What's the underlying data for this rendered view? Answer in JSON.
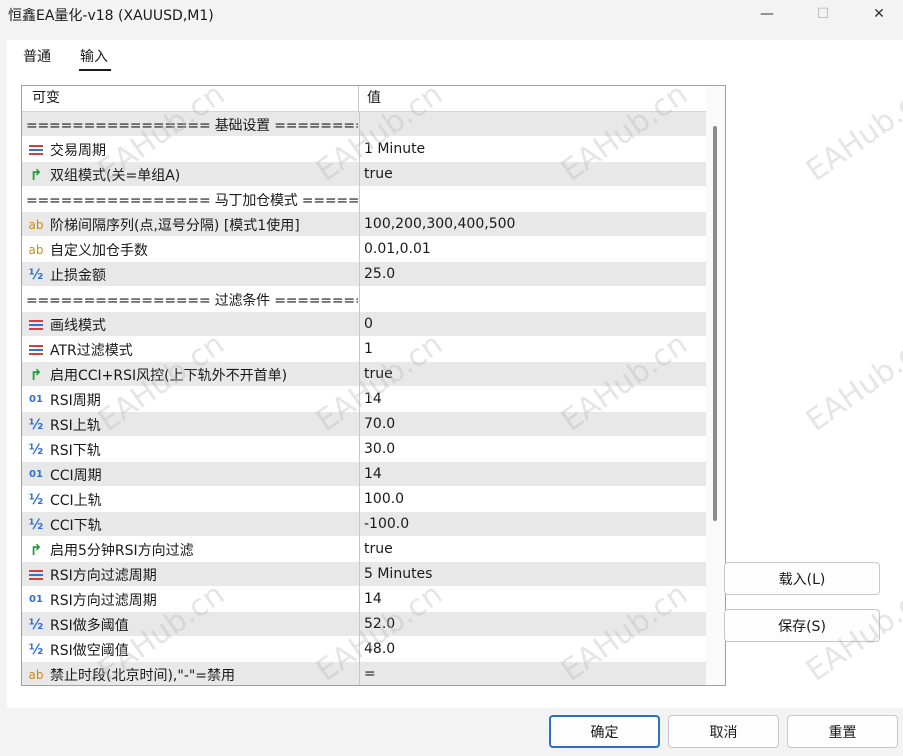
{
  "window": {
    "title": "恒鑫EA量化-v18 (XAUUSD,M1)",
    "minimize_glyph": "—",
    "maximize_glyph": "☐",
    "close_glyph": "✕"
  },
  "tabs": [
    {
      "label": "普通",
      "active": false
    },
    {
      "label": "输入",
      "active": true
    }
  ],
  "grid": {
    "columns": {
      "variable": "可变",
      "value": "值"
    },
    "rows": [
      {
        "type": "section",
        "label": "================ 基础设置 ================...",
        "value": ""
      },
      {
        "type": "list",
        "icon": "list-icon",
        "label": "交易周期",
        "value": "1 Minute"
      },
      {
        "type": "bool",
        "icon": "bool-icon",
        "label": "双组模式(关=单组A)",
        "value": "true"
      },
      {
        "type": "section",
        "label": "================ 马丁加仓模式 ==========...",
        "value": ""
      },
      {
        "type": "string",
        "icon": "string-icon",
        "label": "阶梯间隔序列(点,逗号分隔) [模式1使用]",
        "value": "100,200,300,400,500"
      },
      {
        "type": "string",
        "icon": "string-icon",
        "label": "自定义加仓手数",
        "value": "0.01,0.01"
      },
      {
        "type": "double",
        "icon": "double-icon",
        "label": "止损金额",
        "value": "25.0"
      },
      {
        "type": "section",
        "label": "================ 过滤条件 ================...",
        "value": ""
      },
      {
        "type": "list",
        "icon": "list-icon",
        "label": "画线模式",
        "value": "0"
      },
      {
        "type": "list",
        "icon": "list-icon",
        "label": "ATR过滤模式",
        "value": "1"
      },
      {
        "type": "bool",
        "icon": "bool-icon",
        "label": "启用CCI+RSI风控(上下轨外不开首单)",
        "value": "true"
      },
      {
        "type": "int",
        "icon": "int-icon",
        "label": "RSI周期",
        "value": "14"
      },
      {
        "type": "double",
        "icon": "double-icon",
        "label": "RSI上轨",
        "value": "70.0"
      },
      {
        "type": "double",
        "icon": "double-icon",
        "label": "RSI下轨",
        "value": "30.0"
      },
      {
        "type": "int",
        "icon": "int-icon",
        "label": "CCI周期",
        "value": "14"
      },
      {
        "type": "double",
        "icon": "double-icon",
        "label": "CCI上轨",
        "value": "100.0"
      },
      {
        "type": "double",
        "icon": "double-icon",
        "label": "CCI下轨",
        "value": "-100.0"
      },
      {
        "type": "bool",
        "icon": "bool-icon",
        "label": "启用5分钟RSI方向过滤",
        "value": "true"
      },
      {
        "type": "list",
        "icon": "list-icon",
        "label": "RSI方向过滤周期",
        "value": "5 Minutes"
      },
      {
        "type": "int",
        "icon": "int-icon",
        "label": "RSI方向过滤周期",
        "value": "14"
      },
      {
        "type": "double",
        "icon": "double-icon",
        "label": "RSI做多阈值",
        "value": "52.0"
      },
      {
        "type": "double",
        "icon": "double-icon",
        "label": "RSI做空阈值",
        "value": "48.0"
      },
      {
        "type": "string",
        "icon": "string-icon",
        "label": "禁止时段(北京时间),\"-\"=禁用",
        "value": "="
      }
    ]
  },
  "icon_glyphs": {
    "bool": "↱",
    "string": "ab",
    "double": "½",
    "int": "01"
  },
  "buttons": {
    "load": "载入(L)",
    "save": "保存(S)",
    "ok": "确定",
    "cancel": "取消",
    "reset": "重置"
  },
  "watermark": "EAHub.cn",
  "colors": {
    "accent": "#2d6fc4",
    "row_alt": "#e8e8e8",
    "bool_icon": "#1e9e3a",
    "string_icon": "#c98a18",
    "number_icon": "#2f6fd6"
  }
}
